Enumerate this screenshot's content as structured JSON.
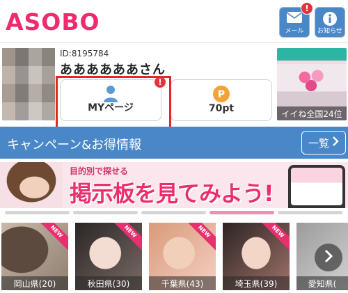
{
  "header": {
    "logo": "ASOBO",
    "mail": {
      "label": "メール",
      "badge": "!"
    },
    "info": {
      "label": "お知らせ"
    }
  },
  "profile": {
    "id_text": "ID:8195784",
    "name": "ああああああさん",
    "my_page": {
      "label": "MYページ",
      "badge": "!"
    },
    "points": {
      "label": "70pt",
      "icon_text": "P"
    },
    "ranking": {
      "label": "イイね全国24位"
    }
  },
  "campaign": {
    "title": "キャンペーン&お得情報",
    "more_label": "一覧"
  },
  "banner": {
    "sub": "目的別で探せる",
    "main": "掲示板を見てみよう!"
  },
  "slider": {
    "count": 5,
    "active_index": 3
  },
  "regions": [
    {
      "label": "岡山県(20)",
      "new": "NEW"
    },
    {
      "label": "秋田県(30)",
      "new": "NEW"
    },
    {
      "label": "千葉県(43)",
      "new": "NEW"
    },
    {
      "label": "埼玉県(39)",
      "new": "NEW"
    },
    {
      "label": "愛知県(",
      "new": ""
    }
  ],
  "colors": {
    "brand_pink": "#f12a6e",
    "header_blue": "#4a87c8",
    "badge_red": "#e5333e",
    "highlight_red": "#e22727",
    "point_orange": "#f3a233",
    "user_icon_blue": "#5b9bd1"
  },
  "icons": {
    "mail": "envelope-icon",
    "info": "info-icon",
    "my_page": "user-icon",
    "points": "point-coin-icon",
    "more": "chevron-right-icon",
    "next": "chevron-right-icon"
  }
}
